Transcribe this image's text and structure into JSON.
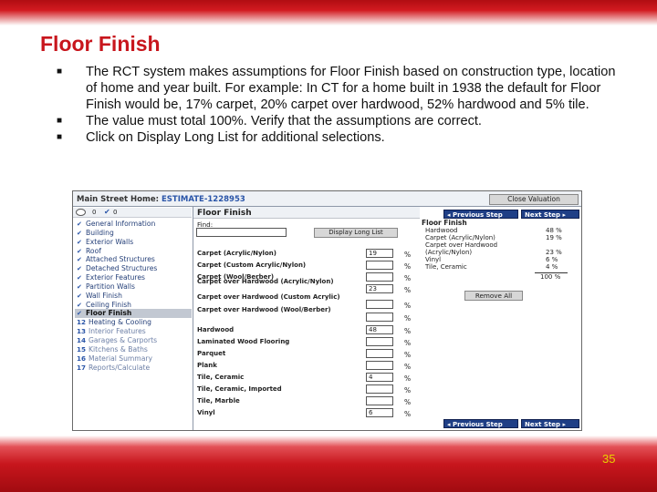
{
  "slide": {
    "title": "Floor Finish",
    "bullets": [
      "The RCT system makes assumptions for Floor Finish based on construction type, location of home and year built.  For example: In CT for a home built in 1938 the default for Floor Finish would be, 17% carpet, 20% carpet over hardwood, 52% hardwood  and 5% tile.",
      "The value must total 100%. Verify that the assumptions are correct.",
      "Click on Display Long List for additional selections."
    ],
    "page_number": "35"
  },
  "app": {
    "title_prefix": "Main Street Home: ",
    "estimate_id": "ESTIMATE-1228953",
    "close_label": "Close Valuation",
    "toolbar_count_1": "0",
    "toolbar_count_2": "0",
    "sidebar": [
      {
        "label": "General Information",
        "state": "done"
      },
      {
        "label": "Building",
        "state": "done"
      },
      {
        "label": "Exterior Walls",
        "state": "done"
      },
      {
        "label": "Roof",
        "state": "done"
      },
      {
        "label": "Attached Structures",
        "state": "done"
      },
      {
        "label": "Detached Structures",
        "state": "done"
      },
      {
        "label": "Exterior Features",
        "state": "done"
      },
      {
        "label": "Partition Walls",
        "state": "done"
      },
      {
        "label": "Wall Finish",
        "state": "done"
      },
      {
        "label": "Ceiling Finish",
        "state": "done"
      },
      {
        "label": "Floor Finish",
        "state": "current"
      },
      {
        "num": "12",
        "label": "Heating & Cooling",
        "state": "numbered"
      },
      {
        "num": "13",
        "label": "Interior Features",
        "state": "todo"
      },
      {
        "num": "14",
        "label": "Garages & Carports",
        "state": "todo"
      },
      {
        "num": "15",
        "label": "Kitchens & Baths",
        "state": "todo"
      },
      {
        "num": "16",
        "label": "Material Summary",
        "state": "todo"
      },
      {
        "num": "17",
        "label": "Reports/Calculate",
        "state": "todo"
      }
    ],
    "main": {
      "title": "Floor Finish",
      "find_label": "Find:",
      "find_value": "",
      "long_list_label": "Display Long List",
      "percent_symbol": "%",
      "rows": [
        {
          "label": "Carpet (Acrylic/Nylon)",
          "value": "19"
        },
        {
          "label": "Carpet (Custom Acrylic/Nylon)",
          "value": ""
        },
        {
          "label": "Carpet (Wool/Berber)",
          "value": ""
        },
        {
          "label": "Carpet over Hardwood (Acrylic/Nylon)",
          "value": "23"
        },
        {
          "label": "Carpet over Hardwood (Custom Acrylic)",
          "value": ""
        },
        {
          "label": "Carpet over Hardwood (Wool/Berber)",
          "value": ""
        },
        {
          "label": "Hardwood",
          "value": "48"
        },
        {
          "label": "Laminated Wood Flooring",
          "value": ""
        },
        {
          "label": "Parquet",
          "value": ""
        },
        {
          "label": "Plank",
          "value": ""
        },
        {
          "label": "Tile, Ceramic",
          "value": "4"
        },
        {
          "label": "Tile, Ceramic, Imported",
          "value": ""
        },
        {
          "label": "Tile, Marble",
          "value": ""
        },
        {
          "label": "Vinyl",
          "value": "6"
        }
      ]
    },
    "nav": {
      "previous": "Previous Step",
      "next": "Next Step"
    },
    "summary": {
      "title": "Floor Finish",
      "items": [
        {
          "label": "Hardwood",
          "value": "48 %"
        },
        {
          "label": "Carpet (Acrylic/Nylon)",
          "value": "19 %"
        },
        {
          "label": "Carpet over Hardwood (Acrylic/Nylon)",
          "value": "23 %"
        },
        {
          "label": "Vinyl",
          "value": "6 %"
        },
        {
          "label": "Tile, Ceramic",
          "value": "4 %"
        }
      ],
      "total": "100 %",
      "remove_label": "Remove All"
    }
  }
}
